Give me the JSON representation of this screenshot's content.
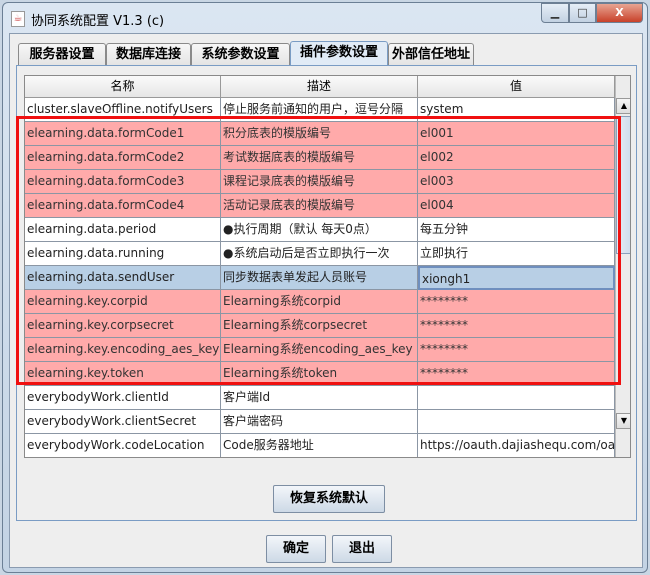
{
  "window": {
    "title": "协同系统配置 V1.3 (c)",
    "minimize": "▁",
    "maximize": "□",
    "close": "X"
  },
  "tabs": [
    {
      "label": "服务器设置"
    },
    {
      "label": "数据库连接"
    },
    {
      "label": "系统参数设置"
    },
    {
      "label": "插件参数设置",
      "active": true
    },
    {
      "label": "外部信任地址"
    }
  ],
  "table": {
    "headers": [
      "名称",
      "描述",
      "值"
    ],
    "rows": [
      {
        "name": "cluster.slaveOffline.notifyUsers",
        "desc": "停止服务前通知的用户，逗号分隔",
        "value": "system",
        "style": "normal"
      },
      {
        "name": "elearning.data.formCode1",
        "desc": "积分底表的模版编号",
        "value": "el001",
        "style": "pink"
      },
      {
        "name": "elearning.data.formCode2",
        "desc": "考试数据底表的模版编号",
        "value": "el002",
        "style": "pink"
      },
      {
        "name": "elearning.data.formCode3",
        "desc": "课程记录底表的模版编号",
        "value": "el003",
        "style": "pink"
      },
      {
        "name": "elearning.data.formCode4",
        "desc": "活动记录底表的模版编号",
        "value": "el004",
        "style": "pink"
      },
      {
        "name": "elearning.data.period",
        "desc": "●执行周期（默认 每天0点）",
        "value": "每五分钟",
        "style": "normal"
      },
      {
        "name": "elearning.data.running",
        "desc": "●系统启动后是否立即执行一次",
        "value": "立即执行",
        "style": "normal"
      },
      {
        "name": "elearning.data.sendUser",
        "desc": "同步数据表单发起人员账号",
        "value": "xiongh1",
        "style": "sel"
      },
      {
        "name": "elearning.key.corpid",
        "desc": "Elearning系统corpid",
        "value": "********",
        "style": "pink"
      },
      {
        "name": "elearning.key.corpsecret",
        "desc": "Elearning系统corpsecret",
        "value": "********",
        "style": "pink"
      },
      {
        "name": "elearning.key.encoding_aes_key",
        "desc": "Elearning系统encoding_aes_key",
        "value": "********",
        "style": "pink"
      },
      {
        "name": "elearning.key.token",
        "desc": "Elearning系统token",
        "value": "********",
        "style": "pink"
      },
      {
        "name": "everybodyWork.clientId",
        "desc": "客户端Id",
        "value": "",
        "style": "normal"
      },
      {
        "name": "everybodyWork.clientSecret",
        "desc": "客户端密码",
        "value": "",
        "style": "normal"
      },
      {
        "name": "everybodyWork.codeLocation",
        "desc": "Code服务器地址",
        "value": "https://oauth.dajiashequ.com/oau...",
        "style": "normal"
      }
    ],
    "colors": {
      "highlight": "#ffaaaa",
      "selected": "#b8cfe5",
      "annotation_box": "#f01010"
    }
  },
  "buttons": {
    "restore": "恢复系统默认",
    "ok": "确定",
    "exit": "退出"
  }
}
